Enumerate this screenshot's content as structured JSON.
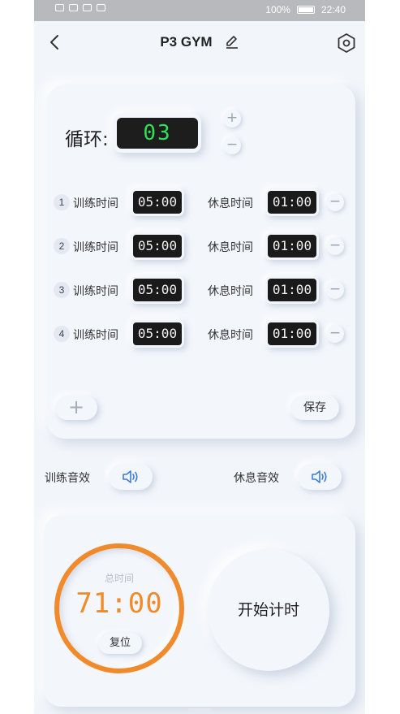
{
  "status_bar": {
    "battery": "100%",
    "time": "22:40"
  },
  "header": {
    "title": "P3 GYM"
  },
  "cycle": {
    "label": "循环:",
    "value": "03"
  },
  "intervals": [
    {
      "index": "1",
      "train_label": "训练时间",
      "train_time": "05:00",
      "rest_label": "休息时间",
      "rest_time": "01:00"
    },
    {
      "index": "2",
      "train_label": "训练时间",
      "train_time": "05:00",
      "rest_label": "休息时间",
      "rest_time": "01:00"
    },
    {
      "index": "3",
      "train_label": "训练时间",
      "train_time": "05:00",
      "rest_label": "休息时间",
      "rest_time": "01:00"
    },
    {
      "index": "4",
      "train_label": "训练时间",
      "train_time": "05:00",
      "rest_label": "休息时间",
      "rest_time": "01:00"
    }
  ],
  "actions": {
    "add": "+",
    "save": "保存",
    "plus": "+",
    "minus": "−"
  },
  "sound": {
    "train_label": "训练音效",
    "rest_label": "休息音效"
  },
  "timer": {
    "total_label": "总时间",
    "total_time": "71:00",
    "reset_label": "复位",
    "start_label": "开始计时"
  },
  "colors": {
    "accent": "#f08a2b",
    "cycle_digits": "#2ee05a",
    "icon_blue": "#3b7be0"
  }
}
